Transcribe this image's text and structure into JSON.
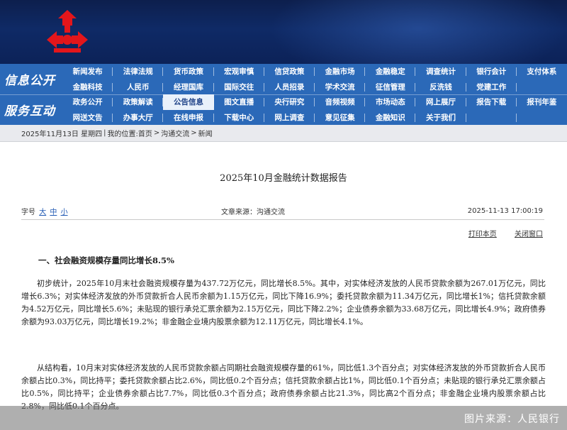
{
  "header": {
    "logo_icon": "pboc-emblem-icon",
    "brand_color": "#e3161b"
  },
  "nav": {
    "section1_label": "信息公开",
    "section2_label": "服务互动",
    "rows": [
      [
        "新闻发布",
        "法律法规",
        "货币政策",
        "宏观审慎",
        "信贷政策",
        "金融市场",
        "金融稳定",
        "调查统计",
        "银行会计",
        "支付体系"
      ],
      [
        "金融科技",
        "人民币",
        "经理国库",
        "国际交往",
        "人员招录",
        "学术交流",
        "征信管理",
        "反洗钱",
        "党建工作",
        ""
      ],
      [
        "政务公开",
        "政策解读",
        "公告信息",
        "图文直播",
        "央行研究",
        "音频视频",
        "市场动态",
        "网上展厅",
        "报告下载",
        "报刊年鉴"
      ],
      [
        "网送文告",
        "办事大厅",
        "在线申报",
        "下载中心",
        "网上调查",
        "意见征集",
        "金融知识",
        "关于我们",
        "",
        ""
      ]
    ],
    "active": "公告信息"
  },
  "breadcrumb": {
    "date": "2025年11月13日 星期四",
    "prefix": "我的位置:",
    "home": "首页",
    "level1": "沟通交流",
    "level2": "新闻"
  },
  "article": {
    "title": "2025年10月金融统计数据报告",
    "font_size_label": "字号",
    "font_large": "大",
    "font_medium": "中",
    "font_small": "小",
    "source": "文章来源：沟通交流",
    "date": "2025-11-13 17:00:19",
    "print_label": "打印本页",
    "close_label": "关闭窗口",
    "heading1": "一、社会融资规模存量同比增长8.5%",
    "paragraph1": "初步统计，2025年10月末社会融资规模存量为437.72万亿元，同比增长8.5%。其中，对实体经济发放的人民币贷款余额为267.01万亿元，同比增长6.3%；对实体经济发放的外币贷款折合人民币余额为1.15万亿元，同比下降16.9%；委托贷款余额为11.34万亿元，同比增长1%；信托贷款余额为4.52万亿元，同比增长5.6%；未贴现的银行承兑汇票余额为2.15万亿元，同比下降2.2%；企业债券余额为33.68万亿元，同比增长4.9%；政府债券余额为93.03万亿元，同比增长19.2%；非金融企业境内股票余额为12.11万亿元，同比增长4.1%。",
    "paragraph2": "从结构看，10月末对实体经济发放的人民币贷款余额占同期社会融资规模存量的61%，同比低1.3个百分点；对实体经济发放的外币贷款折合人民币余额占比0.3%，同比持平；委托贷款余额占比2.6%，同比低0.2个百分点；信托贷款余额占比1%，同比低0.1个百分点；未贴现的银行承兑汇票余额占比0.5%，同比持平；企业债券余额占比7.7%，同比低0.3个百分点；政府债券余额占比21.3%，同比高2个百分点；非金融企业境内股票余额占比2.8%，同比低0.1个百分点。"
  },
  "watermark": {
    "text": "图片来源：人民银行"
  }
}
